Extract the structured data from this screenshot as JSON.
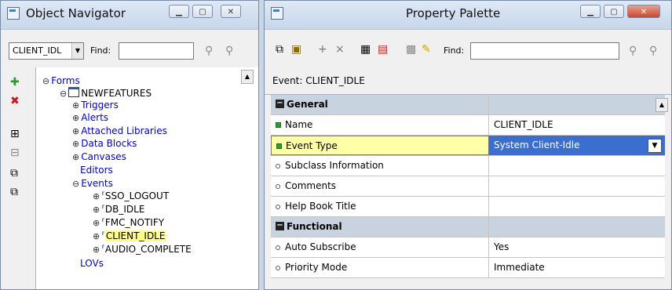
{
  "navigator": {
    "title": "Object Navigator",
    "combo_value": "CLIENT_IDL",
    "find_label": "Find:",
    "tree": {
      "forms": "Forms",
      "module": "NEWFEATURES",
      "triggers": "Triggers",
      "alerts": "Alerts",
      "attached_libraries": "Attached Libraries",
      "data_blocks": "Data Blocks",
      "canvases": "Canvases",
      "editors": "Editors",
      "events": "Events",
      "event_items": [
        "SSO_LOGOUT",
        "DB_IDLE",
        "FMC_NOTIFY",
        "CLIENT_IDLE",
        "AUDIO_COMPLETE"
      ],
      "lovs": "LOVs"
    }
  },
  "palette": {
    "title": "Property Palette",
    "find_label": "Find:",
    "event_line": "Event: CLIENT_IDLE",
    "rows": [
      {
        "name": "General",
        "value": ""
      },
      {
        "name": "Name",
        "value": "CLIENT_IDLE"
      },
      {
        "name": "Event Type",
        "value": "System Client-Idle"
      },
      {
        "name": "Subclass Information",
        "value": ""
      },
      {
        "name": "Comments",
        "value": ""
      },
      {
        "name": "Help Book Title",
        "value": ""
      },
      {
        "name": "Functional",
        "value": ""
      },
      {
        "name": "Auto Subscribe",
        "value": "Yes"
      },
      {
        "name": "Priority Mode",
        "value": "Immediate"
      }
    ]
  },
  "icons": {
    "create": "plus-icon",
    "delete": "x-icon",
    "expand": "expand-icon",
    "collapse": "collapse-icon",
    "expand_all": "expand-all-icon",
    "collapse_all": "collapse-all-icon"
  },
  "colors": {
    "selection_highlight": "#ffff88",
    "value_selected": "#3a6fd0",
    "section_header": "#c9d3e0"
  }
}
